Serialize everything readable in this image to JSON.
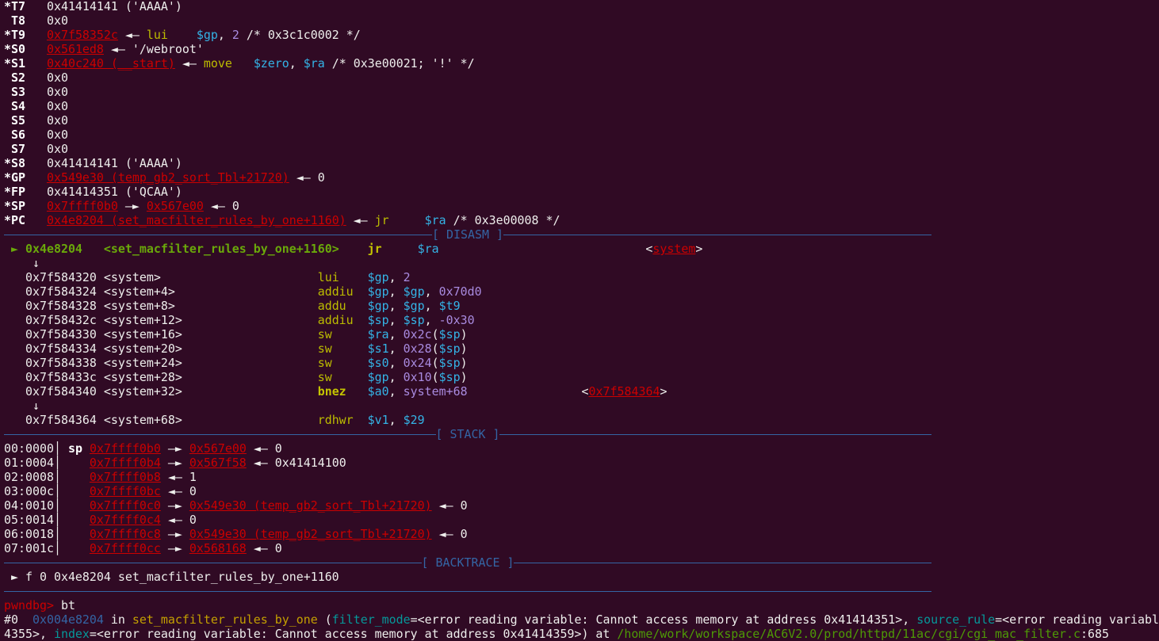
{
  "colors": {
    "background": "#300a24",
    "address": "#cc0000",
    "separator": "#3465a4",
    "mnemonic": "#bcbc00",
    "register": "#34b3e6",
    "immediate": "#a98be0",
    "current": "#6aa80a"
  },
  "lines": [
    {
      "type": "register",
      "segs": [
        {
          "t": "*T7",
          "k": "b"
        },
        {
          "t": "   0x41414141 ('AAAA')",
          "k": "w"
        }
      ]
    },
    {
      "type": "register",
      "segs": [
        {
          "t": " T8",
          "k": "b"
        },
        {
          "t": "   0x0",
          "k": "w"
        }
      ]
    },
    {
      "type": "register",
      "segs": [
        {
          "t": "*T9",
          "k": "b"
        },
        {
          "t": "   ",
          "k": "w"
        },
        {
          "t": "0x7f58352c",
          "k": "r"
        },
        {
          "t": " ◄— ",
          "k": "w"
        },
        {
          "t": "lui",
          "k": "y"
        },
        {
          "t": "    ",
          "k": "w"
        },
        {
          "t": "$gp",
          "k": "c"
        },
        {
          "t": ", ",
          "k": "w"
        },
        {
          "t": "2",
          "k": "p"
        },
        {
          "t": " /* 0x3c1c0002 */",
          "k": "w"
        }
      ]
    },
    {
      "type": "register",
      "segs": [
        {
          "t": "*S0",
          "k": "b"
        },
        {
          "t": "   ",
          "k": "w"
        },
        {
          "t": "0x561ed8",
          "k": "r"
        },
        {
          "t": " ◄— '/webroot'",
          "k": "w"
        }
      ]
    },
    {
      "type": "register",
      "segs": [
        {
          "t": "*S1",
          "k": "b"
        },
        {
          "t": "   ",
          "k": "w"
        },
        {
          "t": "0x40c240 (__start)",
          "k": "r"
        },
        {
          "t": " ◄— ",
          "k": "w"
        },
        {
          "t": "move",
          "k": "y"
        },
        {
          "t": "   ",
          "k": "w"
        },
        {
          "t": "$zero",
          "k": "c"
        },
        {
          "t": ", ",
          "k": "w"
        },
        {
          "t": "$ra",
          "k": "c"
        },
        {
          "t": " /* 0x3e00021; '!' */",
          "k": "w"
        }
      ]
    },
    {
      "type": "register",
      "segs": [
        {
          "t": " S2",
          "k": "b"
        },
        {
          "t": "   0x0",
          "k": "w"
        }
      ]
    },
    {
      "type": "register",
      "segs": [
        {
          "t": " S3",
          "k": "b"
        },
        {
          "t": "   0x0",
          "k": "w"
        }
      ]
    },
    {
      "type": "register",
      "segs": [
        {
          "t": " S4",
          "k": "b"
        },
        {
          "t": "   0x0",
          "k": "w"
        }
      ]
    },
    {
      "type": "register",
      "segs": [
        {
          "t": " S5",
          "k": "b"
        },
        {
          "t": "   0x0",
          "k": "w"
        }
      ]
    },
    {
      "type": "register",
      "segs": [
        {
          "t": " S6",
          "k": "b"
        },
        {
          "t": "   0x0",
          "k": "w"
        }
      ]
    },
    {
      "type": "register",
      "segs": [
        {
          "t": " S7",
          "k": "b"
        },
        {
          "t": "   0x0",
          "k": "w"
        }
      ]
    },
    {
      "type": "register",
      "segs": [
        {
          "t": "*S8",
          "k": "b"
        },
        {
          "t": "   0x41414141 ('AAAA')",
          "k": "w"
        }
      ]
    },
    {
      "type": "register",
      "segs": [
        {
          "t": "*GP",
          "k": "b"
        },
        {
          "t": "   ",
          "k": "w"
        },
        {
          "t": "0x549e30 (temp_gb2_sort_Tbl+21720)",
          "k": "r"
        },
        {
          "t": " ◄— 0",
          "k": "w"
        }
      ]
    },
    {
      "type": "register",
      "segs": [
        {
          "t": "*FP",
          "k": "b"
        },
        {
          "t": "   0x41414351 ('QCAA')",
          "k": "w"
        }
      ]
    },
    {
      "type": "register",
      "segs": [
        {
          "t": "*SP",
          "k": "b"
        },
        {
          "t": "   ",
          "k": "w"
        },
        {
          "t": "0x7ffff0b0",
          "k": "r"
        },
        {
          "t": " —► ",
          "k": "w"
        },
        {
          "t": "0x567e00",
          "k": "r"
        },
        {
          "t": " ◄— 0",
          "k": "w"
        }
      ]
    },
    {
      "type": "register",
      "segs": [
        {
          "t": "*PC",
          "k": "b"
        },
        {
          "t": "   ",
          "k": "w"
        },
        {
          "t": "0x4e8204 (set_macfilter_rules_by_one+1160)",
          "k": "r"
        },
        {
          "t": " ◄— ",
          "k": "w"
        },
        {
          "t": "jr",
          "k": "y"
        },
        {
          "t": "     ",
          "k": "w"
        },
        {
          "t": "$ra",
          "k": "c"
        },
        {
          "t": " /* 0x3e00008 */",
          "k": "w"
        }
      ]
    },
    {
      "type": "separator",
      "label": "[ DISASM ]"
    },
    {
      "type": "disasm",
      "segs": [
        {
          "t": " ► ",
          "k": "g"
        },
        {
          "t": "0x4e8204   <set_macfilter_rules_by_one+1160>",
          "k": "g"
        },
        {
          "t": "    ",
          "k": "w"
        },
        {
          "t": "jr",
          "k": "yb"
        },
        {
          "t": "     ",
          "k": "w"
        },
        {
          "t": "$ra",
          "k": "c"
        },
        {
          "t": "                             <",
          "k": "w"
        },
        {
          "t": "system",
          "k": "r"
        },
        {
          "t": ">",
          "k": "w"
        }
      ]
    },
    {
      "type": "jump-arrow",
      "segs": [
        {
          "t": "    ↓",
          "k": "w"
        }
      ]
    },
    {
      "type": "disasm",
      "segs": [
        {
          "t": "   0x7f584320 <system>                      ",
          "k": "w"
        },
        {
          "t": "lui",
          "k": "y"
        },
        {
          "t": "    ",
          "k": "w"
        },
        {
          "t": "$gp",
          "k": "c"
        },
        {
          "t": ", ",
          "k": "w"
        },
        {
          "t": "2",
          "k": "p"
        }
      ]
    },
    {
      "type": "disasm",
      "segs": [
        {
          "t": "   0x7f584324 <system+4>                    ",
          "k": "w"
        },
        {
          "t": "addiu",
          "k": "y"
        },
        {
          "t": "  ",
          "k": "w"
        },
        {
          "t": "$gp",
          "k": "c"
        },
        {
          "t": ", ",
          "k": "w"
        },
        {
          "t": "$gp",
          "k": "c"
        },
        {
          "t": ", ",
          "k": "w"
        },
        {
          "t": "0x70d0",
          "k": "p"
        }
      ]
    },
    {
      "type": "disasm",
      "segs": [
        {
          "t": "   0x7f584328 <system+8>                    ",
          "k": "w"
        },
        {
          "t": "addu",
          "k": "y"
        },
        {
          "t": "   ",
          "k": "w"
        },
        {
          "t": "$gp",
          "k": "c"
        },
        {
          "t": ", ",
          "k": "w"
        },
        {
          "t": "$gp",
          "k": "c"
        },
        {
          "t": ", ",
          "k": "w"
        },
        {
          "t": "$t9",
          "k": "c"
        }
      ]
    },
    {
      "type": "disasm",
      "segs": [
        {
          "t": "   0x7f58432c <system+12>                   ",
          "k": "w"
        },
        {
          "t": "addiu",
          "k": "y"
        },
        {
          "t": "  ",
          "k": "w"
        },
        {
          "t": "$sp",
          "k": "c"
        },
        {
          "t": ", ",
          "k": "w"
        },
        {
          "t": "$sp",
          "k": "c"
        },
        {
          "t": ", ",
          "k": "w"
        },
        {
          "t": "-0x30",
          "k": "p"
        }
      ]
    },
    {
      "type": "disasm",
      "segs": [
        {
          "t": "   0x7f584330 <system+16>                   ",
          "k": "w"
        },
        {
          "t": "sw",
          "k": "y"
        },
        {
          "t": "     ",
          "k": "w"
        },
        {
          "t": "$ra",
          "k": "c"
        },
        {
          "t": ", ",
          "k": "w"
        },
        {
          "t": "0x2c",
          "k": "p"
        },
        {
          "t": "(",
          "k": "w"
        },
        {
          "t": "$sp",
          "k": "c"
        },
        {
          "t": ")",
          "k": "w"
        }
      ]
    },
    {
      "type": "disasm",
      "segs": [
        {
          "t": "   0x7f584334 <system+20>                   ",
          "k": "w"
        },
        {
          "t": "sw",
          "k": "y"
        },
        {
          "t": "     ",
          "k": "w"
        },
        {
          "t": "$s1",
          "k": "c"
        },
        {
          "t": ", ",
          "k": "w"
        },
        {
          "t": "0x28",
          "k": "p"
        },
        {
          "t": "(",
          "k": "w"
        },
        {
          "t": "$sp",
          "k": "c"
        },
        {
          "t": ")",
          "k": "w"
        }
      ]
    },
    {
      "type": "disasm",
      "segs": [
        {
          "t": "   0x7f584338 <system+24>                   ",
          "k": "w"
        },
        {
          "t": "sw",
          "k": "y"
        },
        {
          "t": "     ",
          "k": "w"
        },
        {
          "t": "$s0",
          "k": "c"
        },
        {
          "t": ", ",
          "k": "w"
        },
        {
          "t": "0x24",
          "k": "p"
        },
        {
          "t": "(",
          "k": "w"
        },
        {
          "t": "$sp",
          "k": "c"
        },
        {
          "t": ")",
          "k": "w"
        }
      ]
    },
    {
      "type": "disasm",
      "segs": [
        {
          "t": "   0x7f58433c <system+28>                   ",
          "k": "w"
        },
        {
          "t": "sw",
          "k": "y"
        },
        {
          "t": "     ",
          "k": "w"
        },
        {
          "t": "$gp",
          "k": "c"
        },
        {
          "t": ", ",
          "k": "w"
        },
        {
          "t": "0x10",
          "k": "p"
        },
        {
          "t": "(",
          "k": "w"
        },
        {
          "t": "$sp",
          "k": "c"
        },
        {
          "t": ")",
          "k": "w"
        }
      ]
    },
    {
      "type": "disasm",
      "segs": [
        {
          "t": "   0x7f584340 <system+32>                   ",
          "k": "w"
        },
        {
          "t": "bnez",
          "k": "yb"
        },
        {
          "t": "   ",
          "k": "w"
        },
        {
          "t": "$a0",
          "k": "c"
        },
        {
          "t": ", ",
          "k": "w"
        },
        {
          "t": "system+68",
          "k": "p"
        },
        {
          "t": "                <",
          "k": "w"
        },
        {
          "t": "0x7f584364",
          "k": "r"
        },
        {
          "t": ">",
          "k": "w"
        }
      ]
    },
    {
      "type": "jump-arrow",
      "segs": [
        {
          "t": "    ↓",
          "k": "w"
        }
      ]
    },
    {
      "type": "disasm",
      "segs": [
        {
          "t": "   0x7f584364 <system+68>                   ",
          "k": "w"
        },
        {
          "t": "rdhwr",
          "k": "y"
        },
        {
          "t": "  ",
          "k": "w"
        },
        {
          "t": "$v1",
          "k": "c"
        },
        {
          "t": ", ",
          "k": "w"
        },
        {
          "t": "$29",
          "k": "c"
        }
      ]
    },
    {
      "type": "separator",
      "label": "[ STACK ]"
    },
    {
      "type": "stack",
      "segs": [
        {
          "t": "00:0000│ ",
          "k": "w"
        },
        {
          "t": "sp",
          "k": "b"
        },
        {
          "t": " ",
          "k": "w"
        },
        {
          "t": "0x7ffff0b0",
          "k": "r"
        },
        {
          "t": " —► ",
          "k": "w"
        },
        {
          "t": "0x567e00",
          "k": "r"
        },
        {
          "t": " ◄— 0",
          "k": "w"
        }
      ]
    },
    {
      "type": "stack",
      "segs": [
        {
          "t": "01:0004│    ",
          "k": "w"
        },
        {
          "t": "0x7ffff0b4",
          "k": "r"
        },
        {
          "t": " —► ",
          "k": "w"
        },
        {
          "t": "0x567f58",
          "k": "r"
        },
        {
          "t": " ◄— 0x41414100",
          "k": "w"
        }
      ]
    },
    {
      "type": "stack",
      "segs": [
        {
          "t": "02:0008│    ",
          "k": "w"
        },
        {
          "t": "0x7ffff0b8",
          "k": "r"
        },
        {
          "t": " ◄— 1",
          "k": "w"
        }
      ]
    },
    {
      "type": "stack",
      "segs": [
        {
          "t": "03:000c│    ",
          "k": "w"
        },
        {
          "t": "0x7ffff0bc",
          "k": "r"
        },
        {
          "t": " ◄— 0",
          "k": "w"
        }
      ]
    },
    {
      "type": "stack",
      "segs": [
        {
          "t": "04:0010│    ",
          "k": "w"
        },
        {
          "t": "0x7ffff0c0",
          "k": "r"
        },
        {
          "t": " —► ",
          "k": "w"
        },
        {
          "t": "0x549e30 (temp_gb2_sort_Tbl+21720)",
          "k": "r"
        },
        {
          "t": " ◄— 0",
          "k": "w"
        }
      ]
    },
    {
      "type": "stack",
      "segs": [
        {
          "t": "05:0014│    ",
          "k": "w"
        },
        {
          "t": "0x7ffff0c4",
          "k": "r"
        },
        {
          "t": " ◄— 0",
          "k": "w"
        }
      ]
    },
    {
      "type": "stack",
      "segs": [
        {
          "t": "06:0018│    ",
          "k": "w"
        },
        {
          "t": "0x7ffff0c8",
          "k": "r"
        },
        {
          "t": " —► ",
          "k": "w"
        },
        {
          "t": "0x549e30 (temp_gb2_sort_Tbl+21720)",
          "k": "r"
        },
        {
          "t": " ◄— 0",
          "k": "w"
        }
      ]
    },
    {
      "type": "stack",
      "segs": [
        {
          "t": "07:001c│    ",
          "k": "w"
        },
        {
          "t": "0x7ffff0cc",
          "k": "r"
        },
        {
          "t": " —► ",
          "k": "w"
        },
        {
          "t": "0x568168",
          "k": "r"
        },
        {
          "t": " ◄— 0",
          "k": "w"
        }
      ]
    },
    {
      "type": "separator",
      "label": "[ BACKTRACE ]"
    },
    {
      "type": "backtrace",
      "segs": [
        {
          "t": " ► f 0 0x4e8204 set_macfilter_rules_by_one+1160",
          "k": "w"
        }
      ]
    },
    {
      "type": "separator",
      "label": ""
    },
    {
      "type": "prompt",
      "segs": [
        {
          "t": "pwndbg>",
          "k": "rd"
        },
        {
          "t": " bt",
          "k": "w"
        }
      ]
    },
    {
      "type": "output",
      "segs": [
        {
          "t": "#0  ",
          "k": "w"
        },
        {
          "t": "0x004e8204",
          "k": "bl"
        },
        {
          "t": " in ",
          "k": "w"
        },
        {
          "t": "set_macfilter_rules_by_one",
          "k": "o"
        },
        {
          "t": " (",
          "k": "w"
        },
        {
          "t": "filter_mode",
          "k": "t"
        },
        {
          "t": "=<error reading variable: Cannot access memory at address 0x41414351>, ",
          "k": "w"
        },
        {
          "t": "source_rule",
          "k": "t"
        },
        {
          "t": "=<error reading variabl",
          "k": "w"
        }
      ]
    },
    {
      "type": "output",
      "segs": [
        {
          "t": "4355>, ",
          "k": "w"
        },
        {
          "t": "index",
          "k": "t"
        },
        {
          "t": "=<error reading variable: Cannot access memory at address 0x41414359>) at ",
          "k": "w"
        },
        {
          "t": "/home/work/workspace/AC6V2.0/prod/httpd/11ac/cgi/cgi_mac_filter.c",
          "k": "gr"
        },
        {
          "t": ":685",
          "k": "w"
        }
      ]
    }
  ]
}
